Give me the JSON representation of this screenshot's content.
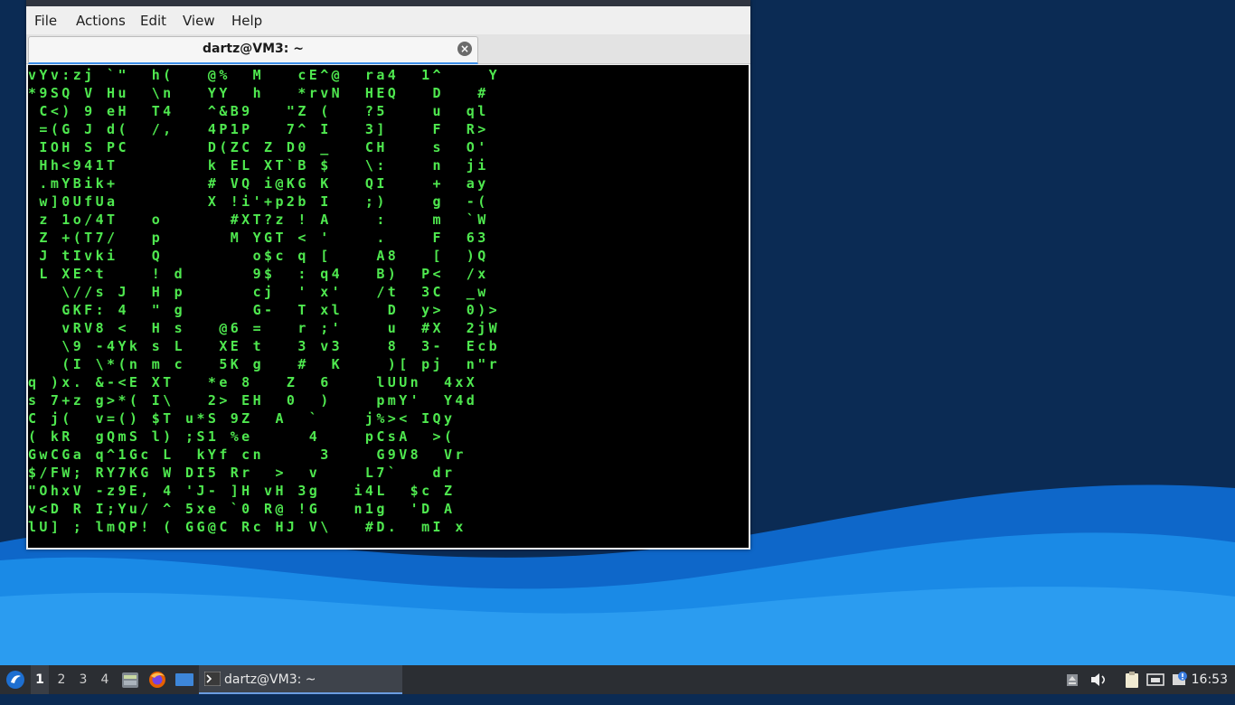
{
  "menubar": {
    "items": [
      "File",
      "Actions",
      "Edit",
      "View",
      "Help"
    ]
  },
  "tab": {
    "title": "dartz@VM3: ~",
    "close": "×"
  },
  "terminal": {
    "lines": [
      "vYv:zj `\"  h(   @%  M   cE^@  ra4  1^    Y",
      "*9SQ V Hu  \\n   YY  h   *rvN  HEQ   D   # ",
      " C<) 9 eH  T4   ^&B9   \"Z (   ?5    u  ql",
      " =(G J d(  /,   4P1P   7^ I   3]    F  R>",
      " IOH S PC       D(ZC Z D0 _   CH    s  O'",
      " Hh<941T        k EL XT`B $   \\:    n  ji",
      " .mYBik+        # VQ i@KG K   QI    +  ay",
      " w]0UfUa        X !i'+p2b I   ;)    g  -(",
      " z 1o/4T   o      #XT?z ! A    :    m  `W",
      " Z +(T7/   p      M YGT < '    .    F  63",
      " J tIvki   Q        o$c q [    A8   [  )Q",
      " L XE^t    ! d      9$  : q4   B)  P<  /x",
      "   \\//s J  H p      cj  ' x'   /t  3C  _w",
      "   GKF: 4  \" g      G-  T xl    D  y>  0)>",
      "   vRV8 <  H s   @6 =   r ;'    u  #X  2jW",
      "   \\9 -4Yk s L   XE t   3 v3    8  3-  Ecb",
      "   (I \\*(n m c   5K g   #  K    )[ pj  n\"r",
      "q )x. &-<E XT   *e 8   Z  6    lUUn  4xX",
      "s 7+z g>*( I\\   2> EH  0  )    pmY'  Y4d",
      "C j(  v=() $T u*S 9Z  A  `    j%>< IQy",
      "( kR  gQmS l) ;S1 %e     4    pCsA  >(",
      "GwCGa q^1Gc L  kYf cn     3    G9V8  Vr",
      "$/FW; RY7KG W DI5 Rr  >  v    L7`   dr",
      "\"OhxV -z9E, 4 'J- ]H vH 3g   i4L  $c Z",
      "v<D R I;Yu/ ^ 5xe `0 R@ !G   n1g  'D A",
      "lU] ; lmQP! ( GG@C Rc HJ V\\   #D.  mI x"
    ]
  },
  "taskbar": {
    "workspaces": [
      "1",
      "2",
      "3",
      "4"
    ],
    "task_label": "dartz@VM3: ~",
    "clock": "16:53"
  },
  "colors": {
    "matrix_green": "#4fe84f",
    "matrix_white": "#ffffff",
    "terminal_bg": "#000000",
    "taskbar_bg": "#2b2e33",
    "wallpaper_dark": "#0b2b54",
    "wallpaper_light": "#1a8ae6"
  }
}
